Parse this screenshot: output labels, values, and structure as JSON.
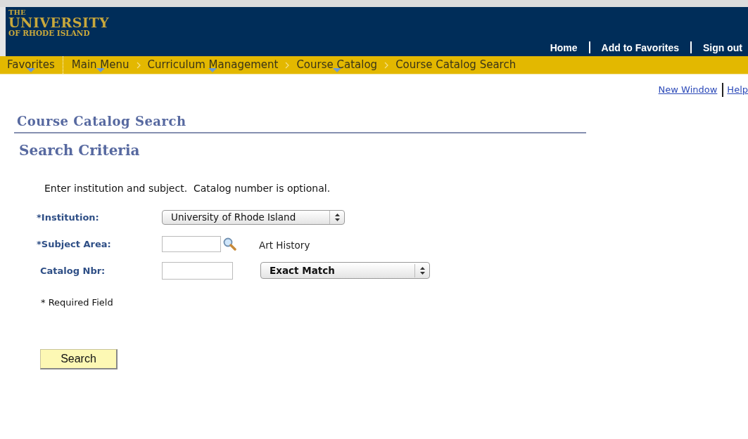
{
  "header": {
    "logo": [
      "THE",
      "UNIVERSITY",
      "OF RHODE ISLAND"
    ],
    "links": [
      "Home",
      "Add to Favorites",
      "Sign out"
    ]
  },
  "breadcrumb": [
    {
      "label": "Favorites",
      "menu": true
    },
    {
      "label": "Main Menu",
      "menu": true
    },
    {
      "label": "Curriculum Management",
      "menu": true
    },
    {
      "label": "Course Catalog",
      "menu": true
    },
    {
      "label": "Course Catalog Search",
      "menu": false
    }
  ],
  "page_links": [
    "New Window",
    "Help"
  ],
  "page_title": "Course Catalog Search",
  "section_title": "Search Criteria",
  "instructions": "Enter institution and subject.  Catalog number is optional.",
  "fields": [
    {
      "kind": "select",
      "label": "*Institution:",
      "value": "University of Rhode Island"
    },
    {
      "kind": "lookup",
      "label": "*Subject Area:",
      "description": "Art History"
    },
    {
      "kind": "text_operator",
      "label": "Catalog Nbr:",
      "operator": "Exact Match"
    }
  ],
  "required_note": "* Required Field",
  "search_button": "Search"
}
